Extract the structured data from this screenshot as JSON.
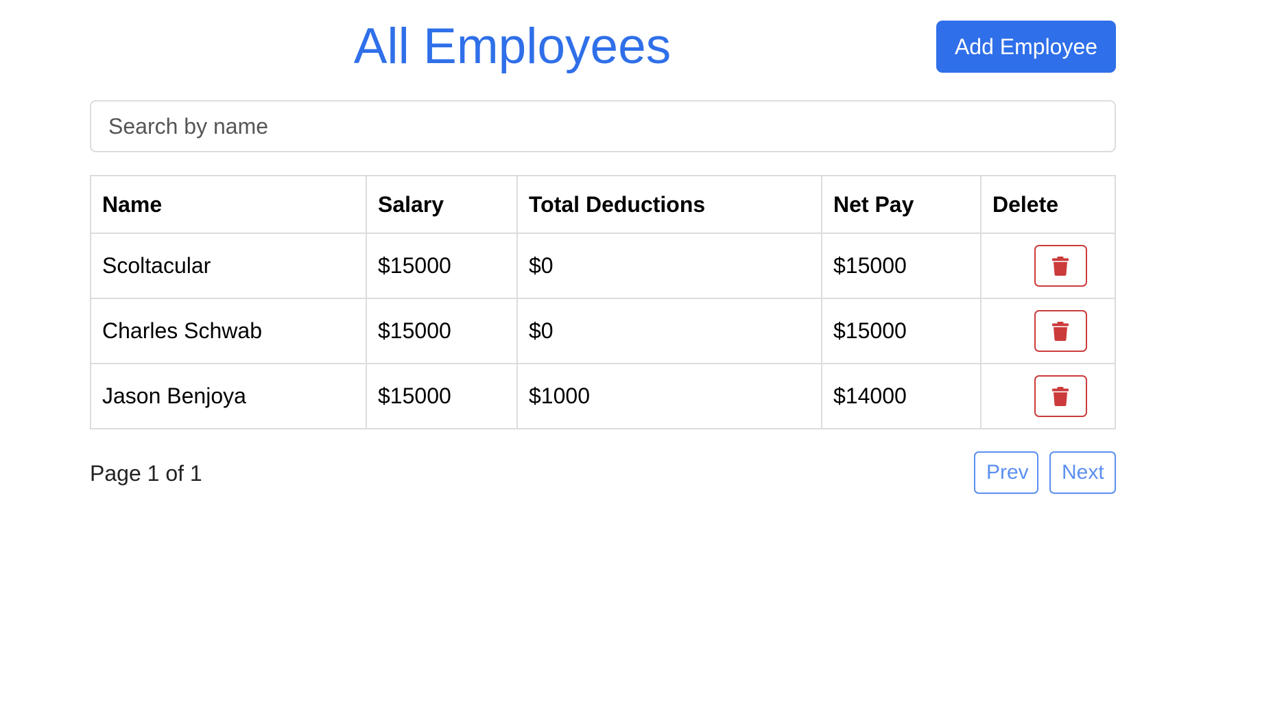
{
  "header": {
    "title": "All Employees",
    "add_button_label": "Add Employee"
  },
  "search": {
    "placeholder": "Search by name",
    "value": ""
  },
  "table": {
    "headers": [
      "Name",
      "Salary",
      "Total Deductions",
      "Net Pay",
      "Delete"
    ],
    "rows": [
      {
        "name": "Scoltacular",
        "salary": "$15000",
        "deductions": "$0",
        "net_pay": "$15000",
        "delete_icon": "trash-icon"
      },
      {
        "name": "Charles Schwab",
        "salary": "$15000",
        "deductions": "$0",
        "net_pay": "$15000",
        "delete_icon": "trash-icon"
      },
      {
        "name": "Jason Benjoya",
        "salary": "$15000",
        "deductions": "$1000",
        "net_pay": "$14000",
        "delete_icon": "trash-icon"
      }
    ]
  },
  "pagination": {
    "info": "Page 1 of 1",
    "prev_label": "Prev",
    "next_label": "Next"
  },
  "colors": {
    "primary": "#2f6fe9",
    "danger": "#cc3b3b",
    "pager_outline": "#5b8ff0",
    "border": "#dcdcdc"
  }
}
